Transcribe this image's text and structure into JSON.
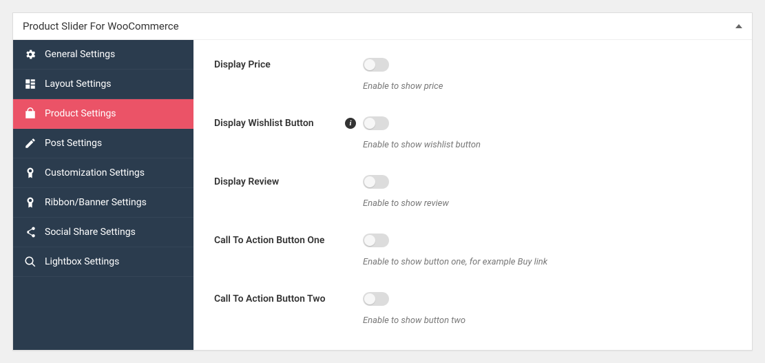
{
  "panel": {
    "title": "Product Slider For WooCommerce"
  },
  "sidebar": {
    "items": [
      {
        "label": "General Settings"
      },
      {
        "label": "Layout Settings"
      },
      {
        "label": "Product Settings"
      },
      {
        "label": "Post Settings"
      },
      {
        "label": "Customization Settings"
      },
      {
        "label": "Ribbon/Banner Settings"
      },
      {
        "label": "Social Share Settings"
      },
      {
        "label": "Lightbox Settings"
      }
    ],
    "active_index": 2
  },
  "fields": [
    {
      "label": "Display Price",
      "desc": "Enable to show price",
      "info": false
    },
    {
      "label": "Display Wishlist Button",
      "desc": "Enable to show wishlist button",
      "info": true
    },
    {
      "label": "Display Review",
      "desc": "Enable to show review",
      "info": false
    },
    {
      "label": "Call To Action Button One",
      "desc": "Enable to show button one, for example Buy link",
      "info": false
    },
    {
      "label": "Call To Action Button Two",
      "desc": "Enable to show button two",
      "info": false
    }
  ],
  "colors": {
    "sidebar_bg": "#2b3c4e",
    "active_bg": "#eb5367"
  }
}
